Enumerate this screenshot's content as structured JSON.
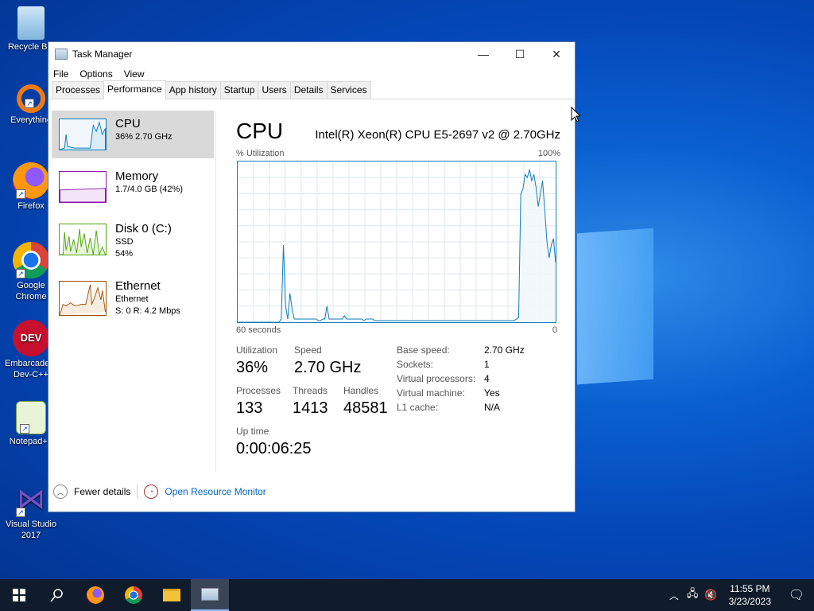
{
  "desktop": {
    "icons": [
      {
        "label": "Recycle Bin"
      },
      {
        "label": "Everything"
      },
      {
        "label": "Firefox"
      },
      {
        "label": "Google Chrome"
      },
      {
        "label": "Embarcadero Dev-C++"
      },
      {
        "label": "Notepad++"
      },
      {
        "label": "Visual Studio 2017"
      }
    ]
  },
  "window": {
    "title": "Task Manager",
    "controls": {
      "minimize": "—",
      "maximize": "☐",
      "close": "✕"
    },
    "menu": [
      "File",
      "Options",
      "View"
    ],
    "tabs": [
      "Processes",
      "Performance",
      "App history",
      "Startup",
      "Users",
      "Details",
      "Services"
    ],
    "active_tab": "Performance"
  },
  "sidebar": {
    "items": [
      {
        "name": "CPU",
        "sub1": "36% 2.70 GHz",
        "sub2": "",
        "color": "#117dbb"
      },
      {
        "name": "Memory",
        "sub1": "1.7/4.0 GB (42%)",
        "sub2": "",
        "color": "#8b12ae"
      },
      {
        "name": "Disk 0 (C:)",
        "sub1": "SSD",
        "sub2": "54%",
        "color": "#4da60c"
      },
      {
        "name": "Ethernet",
        "sub1": "Ethernet",
        "sub2": "S: 0 R: 4.2 Mbps",
        "color": "#a74f01"
      }
    ]
  },
  "cpu": {
    "title": "CPU",
    "model": "Intel(R) Xeon(R) CPU E5-2697 v2 @ 2.70GHz",
    "graph_label": "% Utilization",
    "graph_max": "100%",
    "graph_time": "60 seconds",
    "graph_zero": "0",
    "utilization_label": "Utilization",
    "utilization": "36%",
    "speed_label": "Speed",
    "speed": "2.70 GHz",
    "processes_label": "Processes",
    "processes": "133",
    "threads_label": "Threads",
    "threads": "1413",
    "handles_label": "Handles",
    "handles": "48581",
    "uptime_label": "Up time",
    "uptime": "0:00:06:25",
    "details": [
      {
        "k": "Base speed:",
        "v": "2.70 GHz"
      },
      {
        "k": "Sockets:",
        "v": "1"
      },
      {
        "k": "Virtual processors:",
        "v": "4"
      },
      {
        "k": "Virtual machine:",
        "v": "Yes"
      },
      {
        "k": "L1 cache:",
        "v": "N/A"
      }
    ]
  },
  "footer": {
    "fewer": "Fewer details",
    "monitor": "Open Resource Monitor"
  },
  "taskbar": {
    "time": "11:55 PM",
    "date": "3/23/2023"
  },
  "chart_data": {
    "type": "area",
    "ylabel": "% Utilization",
    "ylim": [
      0,
      100
    ],
    "values": [
      0,
      0,
      0,
      0,
      0,
      0,
      0,
      0,
      0,
      0,
      0,
      0,
      0,
      0,
      0,
      0,
      0,
      0,
      0,
      0,
      2,
      48,
      10,
      2,
      18,
      8,
      2,
      2,
      2,
      2,
      2,
      2,
      2,
      2,
      2,
      2,
      2,
      1,
      1,
      2,
      2,
      10,
      2,
      2,
      2,
      2,
      2,
      2,
      2,
      4,
      2,
      2,
      2,
      2,
      2,
      2,
      2,
      2,
      1,
      2,
      2,
      2,
      2,
      1,
      1,
      1,
      1,
      1,
      1,
      1,
      1,
      1,
      1,
      1,
      1,
      1,
      1,
      1,
      1,
      1,
      1,
      1,
      1,
      1,
      1,
      1,
      1,
      1,
      1,
      1,
      1,
      1,
      1,
      1,
      1,
      1,
      1,
      1,
      1,
      1,
      1,
      1,
      1,
      1,
      1,
      1,
      1,
      1,
      1,
      1,
      1,
      1,
      1,
      1,
      1,
      1,
      1,
      1,
      1,
      1,
      1,
      1,
      1,
      1,
      1,
      1,
      1,
      1,
      2,
      3,
      80,
      83,
      92,
      90,
      95,
      88,
      92,
      84,
      72,
      80,
      88,
      70,
      50,
      40,
      48,
      52,
      37
    ]
  }
}
